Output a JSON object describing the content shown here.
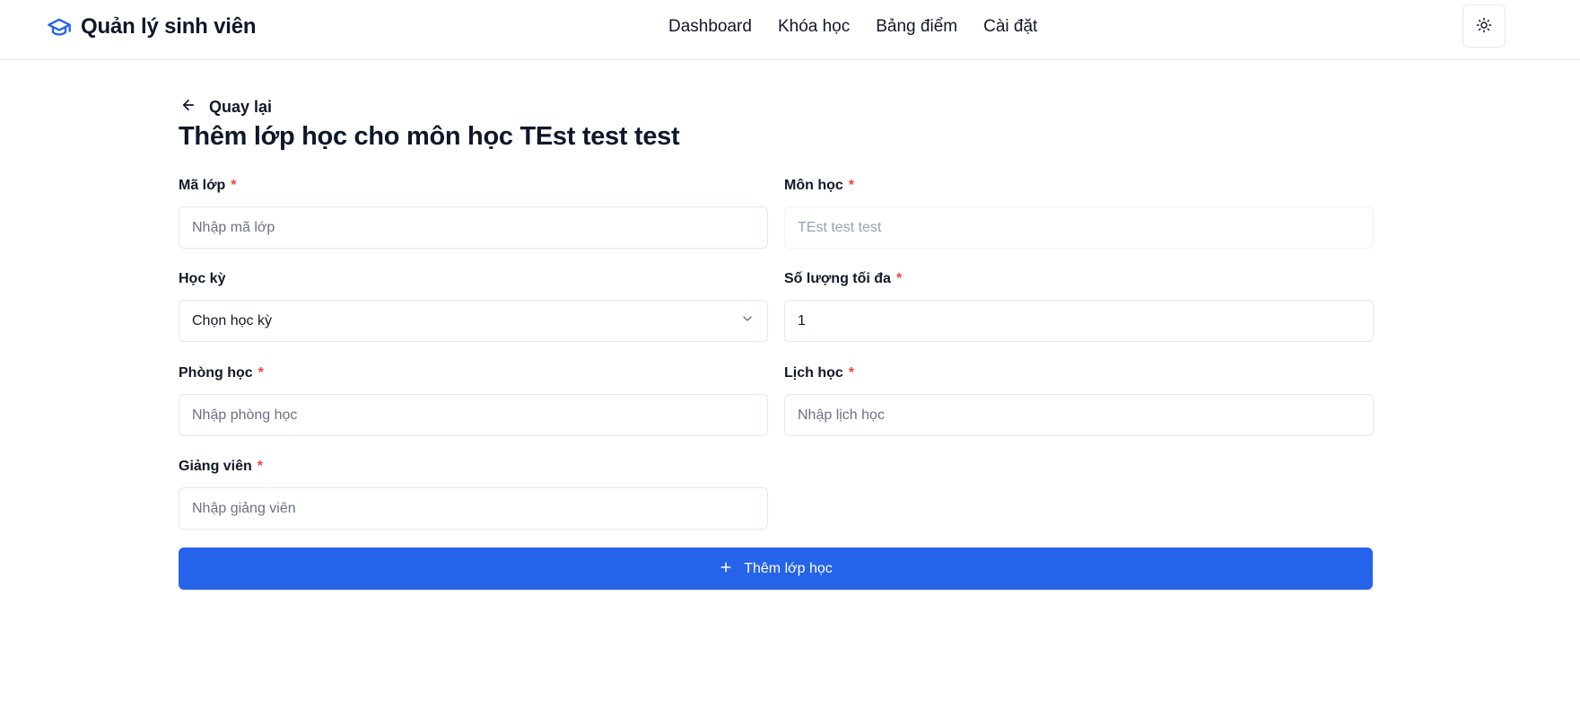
{
  "header": {
    "brand_title": "Quản lý sinh viên",
    "nav": [
      {
        "label": "Dashboard"
      },
      {
        "label": "Khóa học"
      },
      {
        "label": "Bảng điểm"
      },
      {
        "label": "Cài đặt"
      }
    ],
    "brand_color": "#2563eb",
    "theme_toggle_icon": "sun-icon"
  },
  "page": {
    "back_label": "Quay lại",
    "title": "Thêm lớp học cho môn học TEst test test"
  },
  "form": {
    "ma_lop": {
      "label": "Mã lớp",
      "required_mark": "*",
      "placeholder": "Nhập mã lớp",
      "value": ""
    },
    "mon_hoc": {
      "label": "Môn học",
      "required_mark": "*",
      "placeholder": "TEst test test",
      "value": ""
    },
    "hoc_ky": {
      "label": "Học kỳ",
      "selected": "Chọn học kỳ"
    },
    "so_luong": {
      "label": "Số lượng tối đa",
      "required_mark": "*",
      "value": "1"
    },
    "phong_hoc": {
      "label": "Phòng học",
      "required_mark": "*",
      "placeholder": "Nhập phòng học",
      "value": ""
    },
    "lich_hoc": {
      "label": "Lịch học",
      "required_mark": "*",
      "placeholder": "Nhập lịch học",
      "value": ""
    },
    "giang_vien": {
      "label": "Giảng viên",
      "required_mark": "*",
      "placeholder": "Nhập giảng viên",
      "value": ""
    },
    "submit_label": "Thêm lớp học"
  },
  "colors": {
    "primary": "#2563eb",
    "required": "#ef4444",
    "border": "#e2e8f0"
  }
}
